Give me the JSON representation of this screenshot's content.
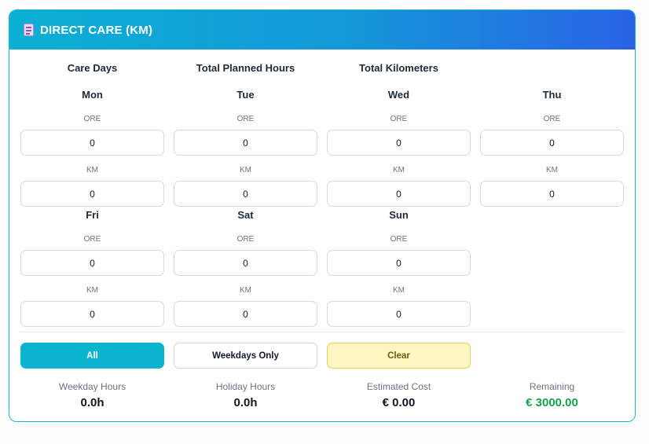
{
  "header": {
    "title": "DIRECT CARE (KM)",
    "icon": "document-icon"
  },
  "columns": [
    "Care Days",
    "Total Planned Hours",
    "Total Kilometers"
  ],
  "hours_label": "ORE",
  "km_label": "KM",
  "days": [
    {
      "name": "Mon",
      "ore": "0",
      "km": "0"
    },
    {
      "name": "Tue",
      "ore": "0",
      "km": "0"
    },
    {
      "name": "Wed",
      "ore": "0",
      "km": "0"
    },
    {
      "name": "Thu",
      "ore": "0",
      "km": "0"
    },
    {
      "name": "Fri",
      "ore": "0",
      "km": "0"
    },
    {
      "name": "Sat",
      "ore": "0",
      "km": "0"
    },
    {
      "name": "Sun",
      "ore": "0",
      "km": "0"
    }
  ],
  "buttons": {
    "all": "All",
    "weekdays": "Weekdays Only",
    "clear": "Clear"
  },
  "stats": {
    "weekday_hours_label": "Weekday Hours",
    "weekday_hours": "0.0h",
    "holiday_hours_label": "Holiday Hours",
    "holiday_hours": "0.0h",
    "estimated_cost_label": "Estimated Cost",
    "estimated_cost": "€ 0.00",
    "remaining_label": "Remaining",
    "remaining": "€ 3000.00"
  },
  "colors": {
    "accent": "#0cb4d0",
    "header_end": "#2a62e6",
    "remaining": "#16a34a",
    "clear_bg": "#fff6c2"
  }
}
